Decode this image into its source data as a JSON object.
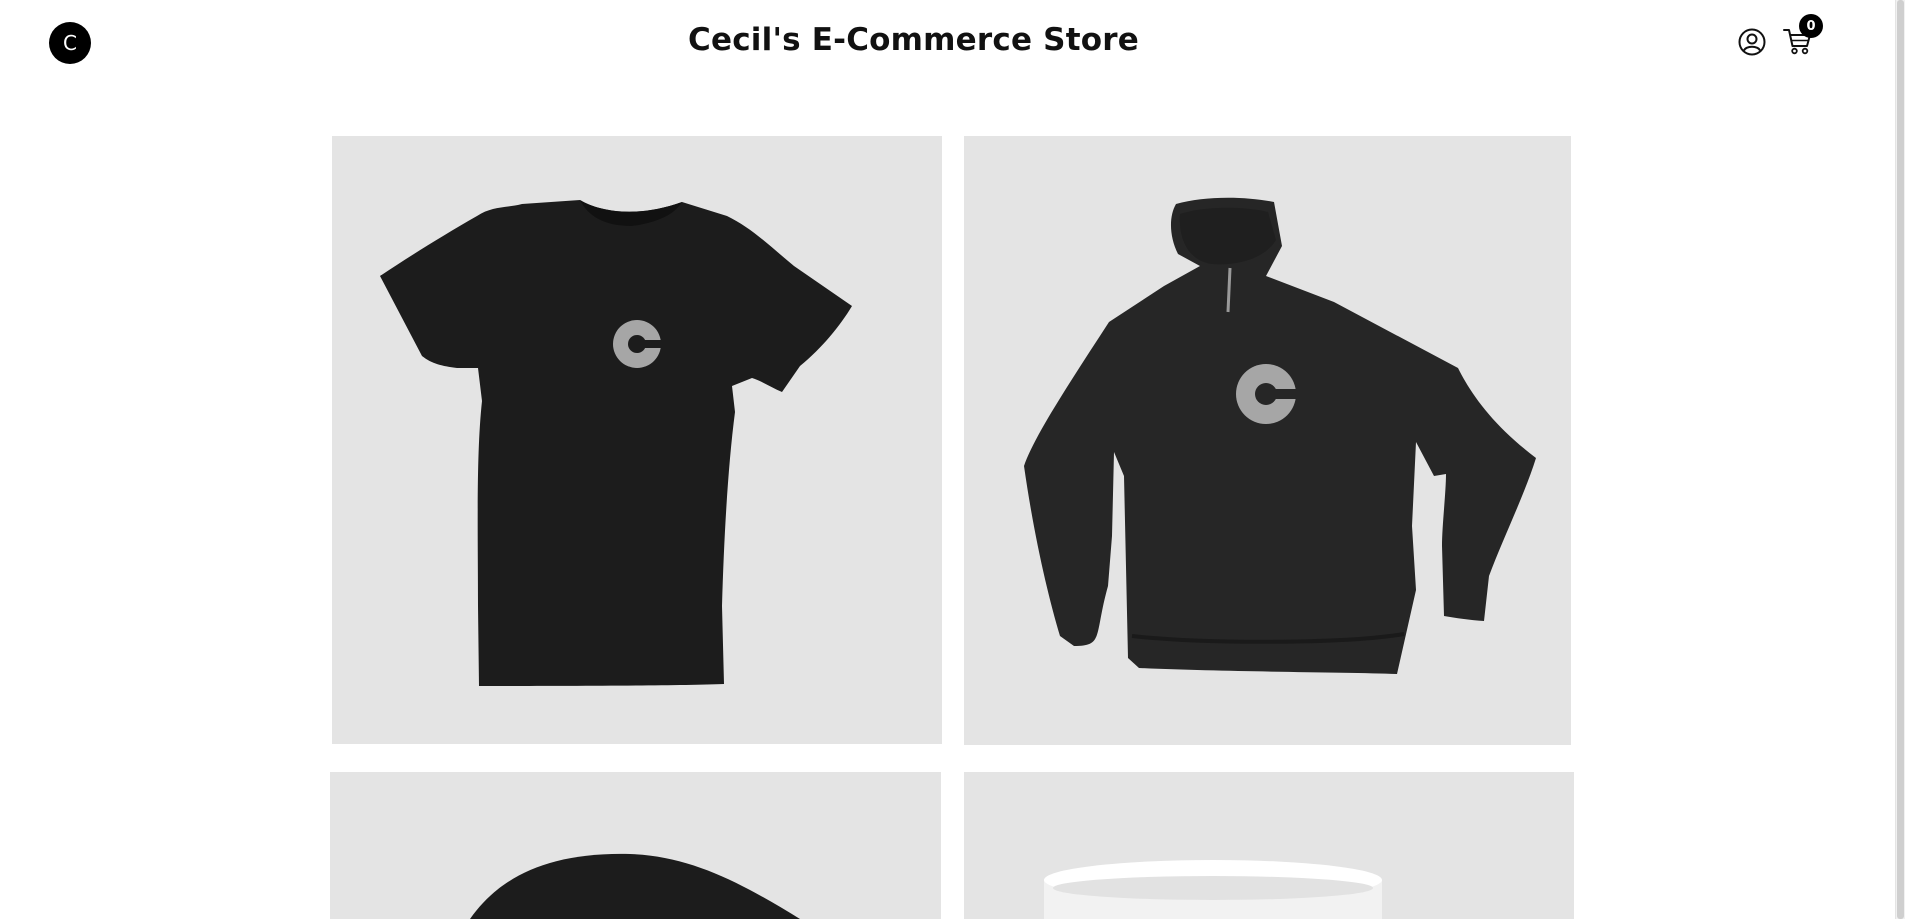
{
  "header": {
    "logo_letter": "C",
    "title": "Cecil's E-Commerce Store",
    "account_icon": "user-circle-icon",
    "cart_icon": "shopping-cart-icon",
    "cart_count": "0"
  },
  "products": [
    {
      "image": "black t-shirt with grey C logo"
    },
    {
      "image": "black hoodie with grey C logo"
    },
    {
      "image": "black cap"
    },
    {
      "image": "white mug"
    }
  ],
  "colors": {
    "card_background": "#e4e4e4",
    "garment": "#1c1c1c",
    "logo_grey": "#a6a6a6",
    "badge": "#000000"
  }
}
